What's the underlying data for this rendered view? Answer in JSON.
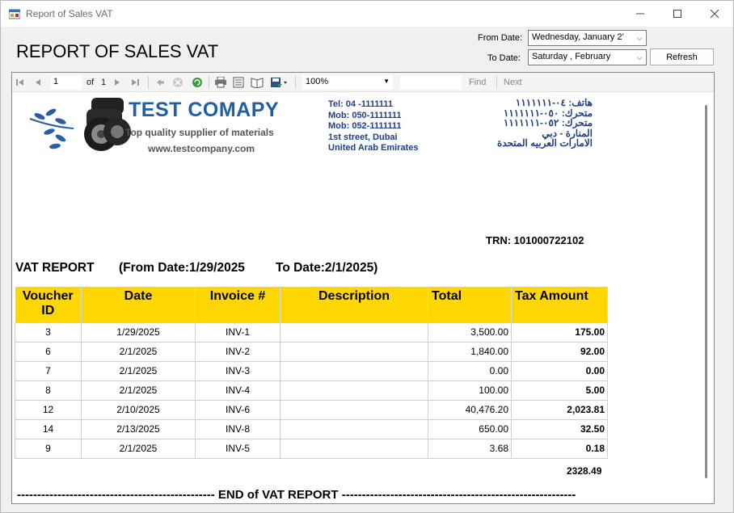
{
  "window": {
    "title": "Report of Sales VAT"
  },
  "form": {
    "heading": "REPORT OF SALES VAT",
    "from_label": "From Date:",
    "from_value": "Wednesday,  January  2’",
    "to_label": "To Date:",
    "to_value": "Saturday  ,  February",
    "refresh_label": "Refresh"
  },
  "toolbar": {
    "page": "1",
    "of_label": "of",
    "total_pages": "1",
    "zoom": "100%",
    "find_label": "Find",
    "next_label": "Next"
  },
  "report": {
    "company": "TEST COMAPY",
    "tagline": "Top quality supplier of materials",
    "website": "www.testcompany.com",
    "contact_en": [
      "Tel:   04  -1111111",
      "Mob: 050-1111111",
      "Mob: 052-1111111",
      "1st street, Dubai",
      "United Arab Emirates"
    ],
    "contact_ar": [
      "هاتف: ٠٤-١١١١١١١",
      "متحرك: ٠٥٠-١١١١١١١",
      "متحرك: ٠٥٢-١١١١١١١",
      "المنارة - دبي",
      "الامارات العربيه المتحدة"
    ],
    "trn": "TRN: 101000722102",
    "vat_title": "VAT REPORT",
    "from_date": "(From Date:1/29/2025",
    "to_date": "To Date:2/1/2025)",
    "columns": [
      "Voucher ID",
      "Date",
      "Invoice #",
      "Description",
      "Total",
      "Tax Amount"
    ],
    "rows": [
      [
        "3",
        "1/29/2025",
        "INV-1",
        "",
        "3,500.00",
        "175.00"
      ],
      [
        "6",
        "2/1/2025",
        "INV-2",
        "",
        "1,840.00",
        "92.00"
      ],
      [
        "7",
        "2/1/2025",
        "INV-3",
        "",
        "0.00",
        "0.00"
      ],
      [
        "8",
        "2/1/2025",
        "INV-4",
        "",
        "100.00",
        "5.00"
      ],
      [
        "12",
        "2/10/2025",
        "INV-6",
        "",
        "40,476.20",
        "2,023.81"
      ],
      [
        "14",
        "2/13/2025",
        "INV-8",
        "",
        "650.00",
        "32.50"
      ],
      [
        "9",
        "2/1/2025",
        "INV-5",
        "",
        "3.68",
        "0.18"
      ]
    ],
    "grand_total": "2328.49",
    "end_text": "------------------------------------------------- END of VAT REPORT ----------------------------------------------------------"
  }
}
